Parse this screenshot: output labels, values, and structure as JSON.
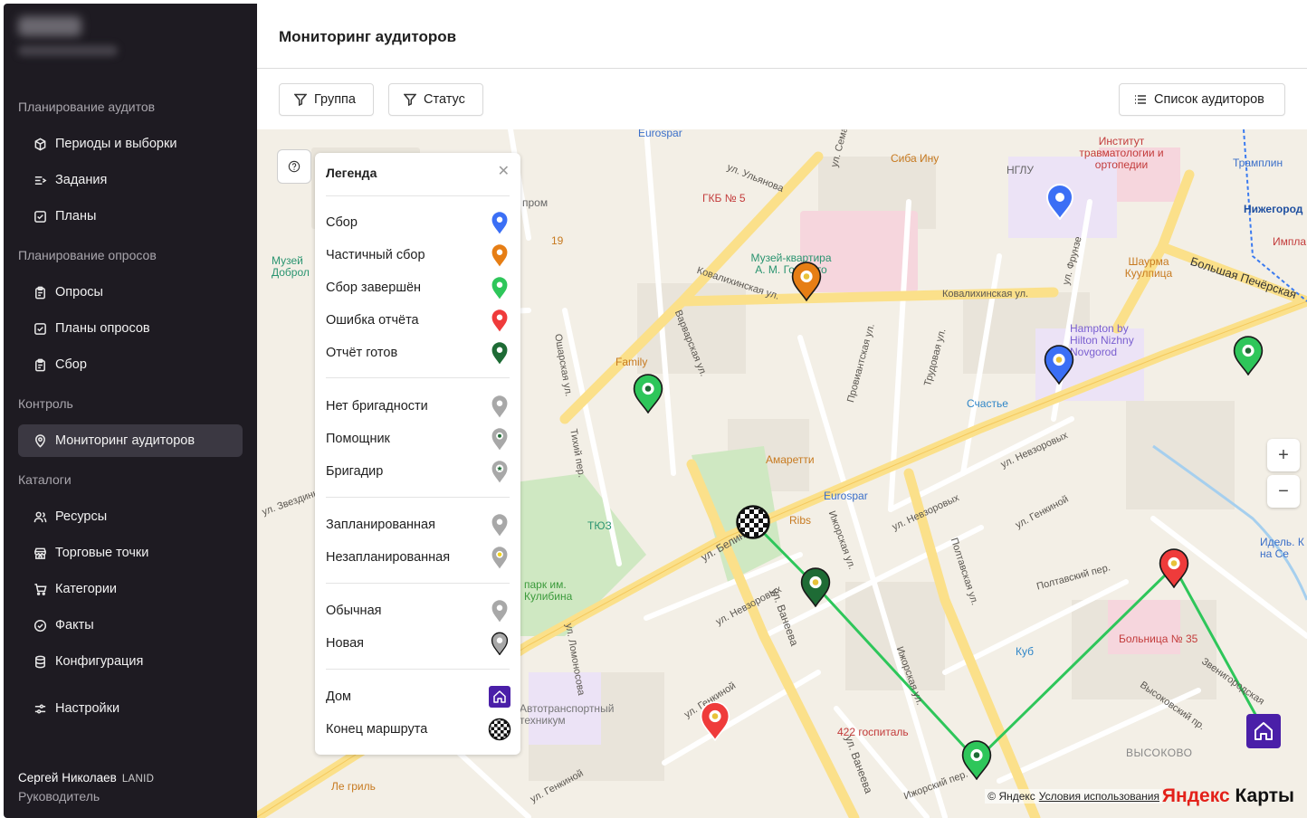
{
  "sidebar": {
    "sections": [
      {
        "label": "Планирование аудитов"
      },
      {
        "label": "Планирование опросов"
      },
      {
        "label": "Контроль"
      },
      {
        "label": "Каталоги"
      }
    ],
    "items": [
      {
        "label": "Периоды и выборки",
        "icon": "cube-icon"
      },
      {
        "label": "Задания",
        "icon": "list-arrow-icon"
      },
      {
        "label": "Планы",
        "icon": "check-square-icon"
      },
      {
        "label": "Опросы",
        "icon": "clipboard-icon"
      },
      {
        "label": "Планы опросов",
        "icon": "check-square-icon"
      },
      {
        "label": "Сбор",
        "icon": "clipboard-icon"
      },
      {
        "label": "Мониторинг аудиторов",
        "icon": "map-pin-icon"
      },
      {
        "label": "Ресурсы",
        "icon": "users-icon"
      },
      {
        "label": "Торговые точки",
        "icon": "store-icon"
      },
      {
        "label": "Категории",
        "icon": "cart-icon"
      },
      {
        "label": "Факты",
        "icon": "check-circle-icon"
      },
      {
        "label": "Конфигурация",
        "icon": "database-icon"
      },
      {
        "label": "Настройки",
        "icon": "sliders-icon"
      }
    ],
    "active_item": "Мониторинг аудиторов",
    "user": {
      "name": "Сергей Николаев",
      "org": "LANID",
      "role": "Руководитель"
    }
  },
  "header": {
    "title": "Мониторинг аудиторов"
  },
  "toolbar": {
    "group_label": "Группа",
    "status_label": "Статус",
    "auditors_list_label": "Список аудиторов"
  },
  "legend": {
    "title": "Легенда",
    "items": [
      {
        "label": "Сбор",
        "color": "#3b6ff5"
      },
      {
        "label": "Частичный сбор",
        "color": "#e67e15"
      },
      {
        "label": "Сбор завершён",
        "color": "#2ec65a"
      },
      {
        "label": "Ошибка отчёта",
        "color": "#ef3b3b"
      },
      {
        "label": "Отчёт готов",
        "color": "#1e6b35"
      },
      {
        "label": "Нет бригадности",
        "color": "#a8a8a8"
      },
      {
        "label": "Помощник",
        "color": "#a8a8a8"
      },
      {
        "label": "Бригадир",
        "color": "#a8a8a8"
      },
      {
        "label": "Запланированная",
        "color": "#a8a8a8"
      },
      {
        "label": "Незапланированная",
        "color": "#a8a8a8"
      },
      {
        "label": "Обычная",
        "color": "#a8a8a8"
      },
      {
        "label": "Новая",
        "color": "#a8a8a8"
      },
      {
        "label": "Дом",
        "color": "#4a1fa8"
      },
      {
        "label": "Конец маршрута",
        "color": "#111111"
      }
    ]
  },
  "map": {
    "streets": [
      "ул. Ульянова",
      "Ковалихинская ул.",
      "Ковалихинская ул.",
      "Большая Печёрская",
      "Варварская ул.",
      "Ошарская ул.",
      "Тихий пер.",
      "Провиантская ул.",
      "Трудовая ул.",
      "ул. Фрунзе",
      "ул. Невзоровых",
      "ул. Невзоровых",
      "ул. Невзоровых",
      "ул. Белинского",
      "ул. Ванеева",
      "ул. Ванеева",
      "Ижорская ул.",
      "Ижорская ул.",
      "Полтавская ул.",
      "Полтавский пер.",
      "ул. Генкиной",
      "ул. Генкиной",
      "ул. Генкиной",
      "Высоковский пр.",
      "Звенигородская",
      "ул. Ломоносова",
      "ул. Звездинка",
      "Ижорский пер.",
      "ул. Семашко"
    ],
    "pois": [
      "Eurospar",
      "Сиба Ину",
      "Институт травматологии и ортопедии",
      "НГЛУ",
      "ГКБ № 5",
      "Музей-квартира А. М. Горького",
      "Family",
      "Hampton by Hilton Nizhny Novgorod",
      "Счастье",
      "Амаретти",
      "Eurospar",
      "ТЮЗ",
      "Ribs",
      "парк им. Кулибина",
      "Шаурма Куулпица",
      "Трамплин",
      "Нижегород",
      "Импла",
      "Куб",
      "Больница № 35",
      "422 госпиталь",
      "Ле гриль",
      "ВЫСОКОВО",
      "Идель. К на Се",
      "19",
      "пром",
      "Музей Доброл",
      "Автотранспортный техникум"
    ],
    "zoom_in": "+",
    "zoom_out": "−",
    "attribution": "© Яндекс",
    "terms": "Условия использования",
    "logo_a": "Яндекс",
    "logo_b": "Карты"
  }
}
